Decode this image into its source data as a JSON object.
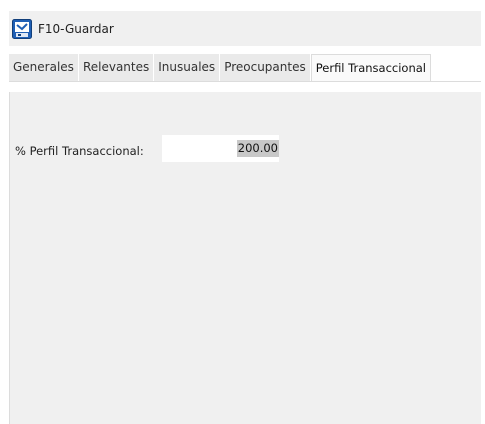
{
  "toolbar": {
    "save_label": "F10-Guardar",
    "save_icon": "save-disk-icon"
  },
  "tabs": [
    {
      "label": "Generales",
      "active": false
    },
    {
      "label": "Relevantes",
      "active": false
    },
    {
      "label": "Inusuales",
      "active": false
    },
    {
      "label": "Preocupantes",
      "active": false
    },
    {
      "label": "Perfil Transaccional",
      "active": true
    }
  ],
  "form": {
    "perfil_label": "% Perfil Transaccional:",
    "perfil_value": "200.00"
  },
  "colors": {
    "toolbar_bg": "#f0f0f0",
    "content_bg": "#f0f0f0",
    "tab_bg": "#eaeaea",
    "selection_bg": "#c8c8c8",
    "icon_blue": "#1f5fb5"
  }
}
